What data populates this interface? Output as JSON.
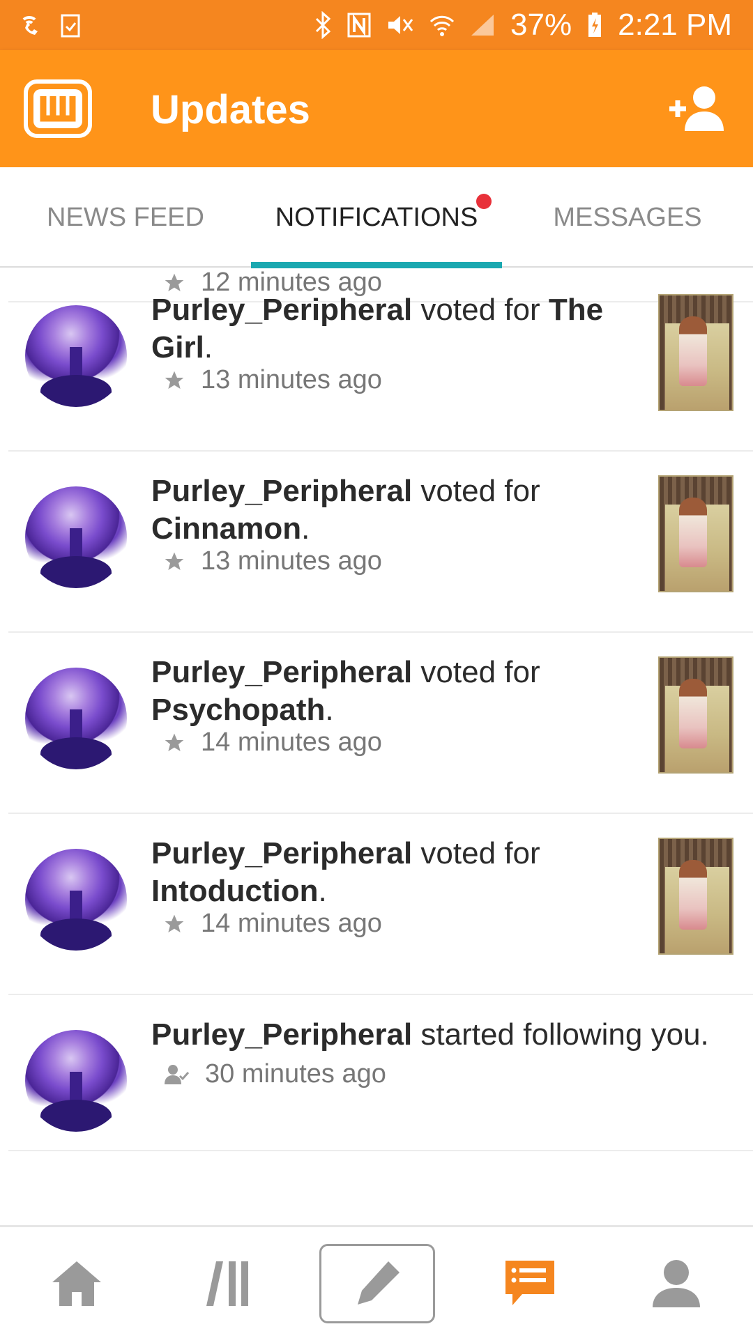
{
  "status_bar": {
    "battery": "37%",
    "time": "2:21 PM"
  },
  "app_bar": {
    "title": "Updates"
  },
  "tabs": [
    {
      "label": "NEWS FEED",
      "active": false
    },
    {
      "label": "NOTIFICATIONS",
      "active": true,
      "has_badge": true
    },
    {
      "label": "MESSAGES",
      "active": false
    }
  ],
  "notifications": [
    {
      "user": "",
      "action": "",
      "target": "",
      "time": "12 minutes ago",
      "icon": "star-icon",
      "has_cover": true
    },
    {
      "user": "Purley_Peripheral",
      "action": " voted for ",
      "target": "The Girl",
      "end": ".",
      "time": "13 minutes ago",
      "icon": "star-icon",
      "has_cover": true
    },
    {
      "user": "Purley_Peripheral",
      "action": " voted for ",
      "target": "Cinnamon",
      "end": ".",
      "time": "13 minutes ago",
      "icon": "star-icon",
      "has_cover": true
    },
    {
      "user": "Purley_Peripheral",
      "action": " voted for ",
      "target": "Psychopath",
      "end": ".",
      "time": "14 minutes ago",
      "icon": "star-icon",
      "has_cover": true
    },
    {
      "user": "Purley_Peripheral",
      "action": " voted for ",
      "target": "Intoduction",
      "end": ".",
      "time": "14 minutes ago",
      "icon": "star-icon",
      "has_cover": true
    },
    {
      "user": "Purley_Peripheral",
      "action": " started following you.",
      "target": "",
      "end": "",
      "time": "30 minutes ago",
      "icon": "follow-icon",
      "has_cover": false
    }
  ],
  "bottom_nav": [
    {
      "name": "home",
      "icon": "home-icon"
    },
    {
      "name": "library",
      "icon": "library-icon"
    },
    {
      "name": "write",
      "icon": "pencil-icon"
    },
    {
      "name": "updates",
      "icon": "chat-icon",
      "active": true
    },
    {
      "name": "profile",
      "icon": "profile-icon"
    }
  ],
  "colors": {
    "status_bar": "#f5861f",
    "app_bar": "#ff9419",
    "tab_indicator": "#1aa8b0",
    "badge": "#e8313a",
    "nav_active": "#f5861f",
    "nav_inactive": "#9a9a9a"
  }
}
